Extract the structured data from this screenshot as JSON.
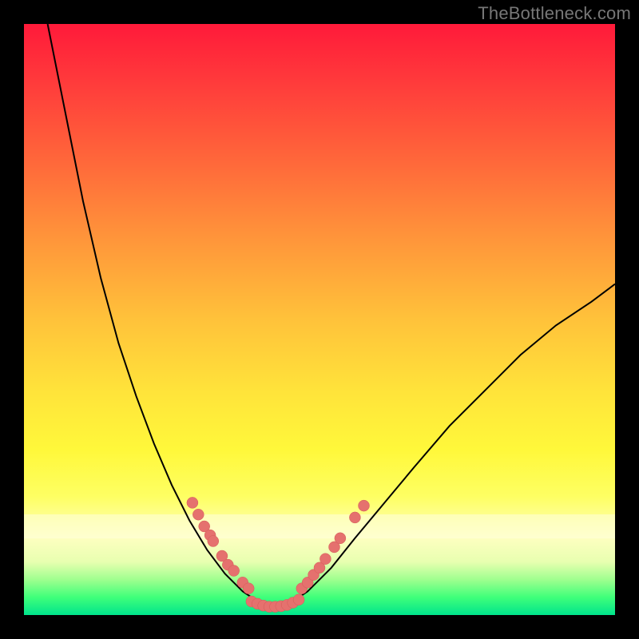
{
  "watermark": "TheBottleneck.com",
  "colors": {
    "dot": "#e5716e",
    "curve": "#000000",
    "background_top": "#ff1a3a",
    "background_bottom": "#00e48c"
  },
  "chart_data": {
    "type": "line",
    "title": "",
    "xlabel": "",
    "ylabel": "",
    "xlim": [
      0,
      100
    ],
    "ylim": [
      0,
      100
    ],
    "grid": false,
    "legend": false,
    "curve_left": [
      {
        "x": 4,
        "y": 100
      },
      {
        "x": 7,
        "y": 85
      },
      {
        "x": 10,
        "y": 70
      },
      {
        "x": 13,
        "y": 57
      },
      {
        "x": 16,
        "y": 46
      },
      {
        "x": 19,
        "y": 37
      },
      {
        "x": 22,
        "y": 29
      },
      {
        "x": 25,
        "y": 22
      },
      {
        "x": 28,
        "y": 16
      },
      {
        "x": 31,
        "y": 11
      },
      {
        "x": 34,
        "y": 7
      },
      {
        "x": 37,
        "y": 4
      },
      {
        "x": 40,
        "y": 2
      },
      {
        "x": 42,
        "y": 1
      }
    ],
    "curve_right": [
      {
        "x": 42,
        "y": 1
      },
      {
        "x": 45,
        "y": 2
      },
      {
        "x": 48,
        "y": 4
      },
      {
        "x": 52,
        "y": 8
      },
      {
        "x": 56,
        "y": 13
      },
      {
        "x": 61,
        "y": 19
      },
      {
        "x": 66,
        "y": 25
      },
      {
        "x": 72,
        "y": 32
      },
      {
        "x": 78,
        "y": 38
      },
      {
        "x": 84,
        "y": 44
      },
      {
        "x": 90,
        "y": 49
      },
      {
        "x": 96,
        "y": 53
      },
      {
        "x": 100,
        "y": 56
      }
    ],
    "series": [
      {
        "name": "left-branch-markers",
        "marker": "circle",
        "color": "#e5716e",
        "points": [
          {
            "x": 28.5,
            "y": 19
          },
          {
            "x": 29.5,
            "y": 17
          },
          {
            "x": 30.5,
            "y": 15
          },
          {
            "x": 31.5,
            "y": 13.5
          },
          {
            "x": 32.0,
            "y": 12.5
          },
          {
            "x": 33.5,
            "y": 10
          },
          {
            "x": 34.5,
            "y": 8.5
          },
          {
            "x": 35.5,
            "y": 7.5
          },
          {
            "x": 37.0,
            "y": 5.5
          },
          {
            "x": 38.0,
            "y": 4.5
          }
        ]
      },
      {
        "name": "valley-markers",
        "marker": "circle",
        "color": "#e5716e",
        "points": [
          {
            "x": 38.5,
            "y": 2.3
          },
          {
            "x": 39.5,
            "y": 1.9
          },
          {
            "x": 40.5,
            "y": 1.6
          },
          {
            "x": 41.5,
            "y": 1.4
          },
          {
            "x": 42.5,
            "y": 1.4
          },
          {
            "x": 43.5,
            "y": 1.5
          },
          {
            "x": 44.5,
            "y": 1.7
          },
          {
            "x": 45.5,
            "y": 2.1
          },
          {
            "x": 46.5,
            "y": 2.6
          }
        ]
      },
      {
        "name": "right-branch-markers",
        "marker": "circle",
        "color": "#e5716e",
        "points": [
          {
            "x": 47.0,
            "y": 4.5
          },
          {
            "x": 48.0,
            "y": 5.5
          },
          {
            "x": 49.0,
            "y": 6.8
          },
          {
            "x": 50.0,
            "y": 8.0
          },
          {
            "x": 51.0,
            "y": 9.5
          },
          {
            "x": 52.5,
            "y": 11.5
          },
          {
            "x": 53.5,
            "y": 13.0
          },
          {
            "x": 56.0,
            "y": 16.5
          },
          {
            "x": 57.5,
            "y": 18.5
          }
        ]
      }
    ]
  }
}
